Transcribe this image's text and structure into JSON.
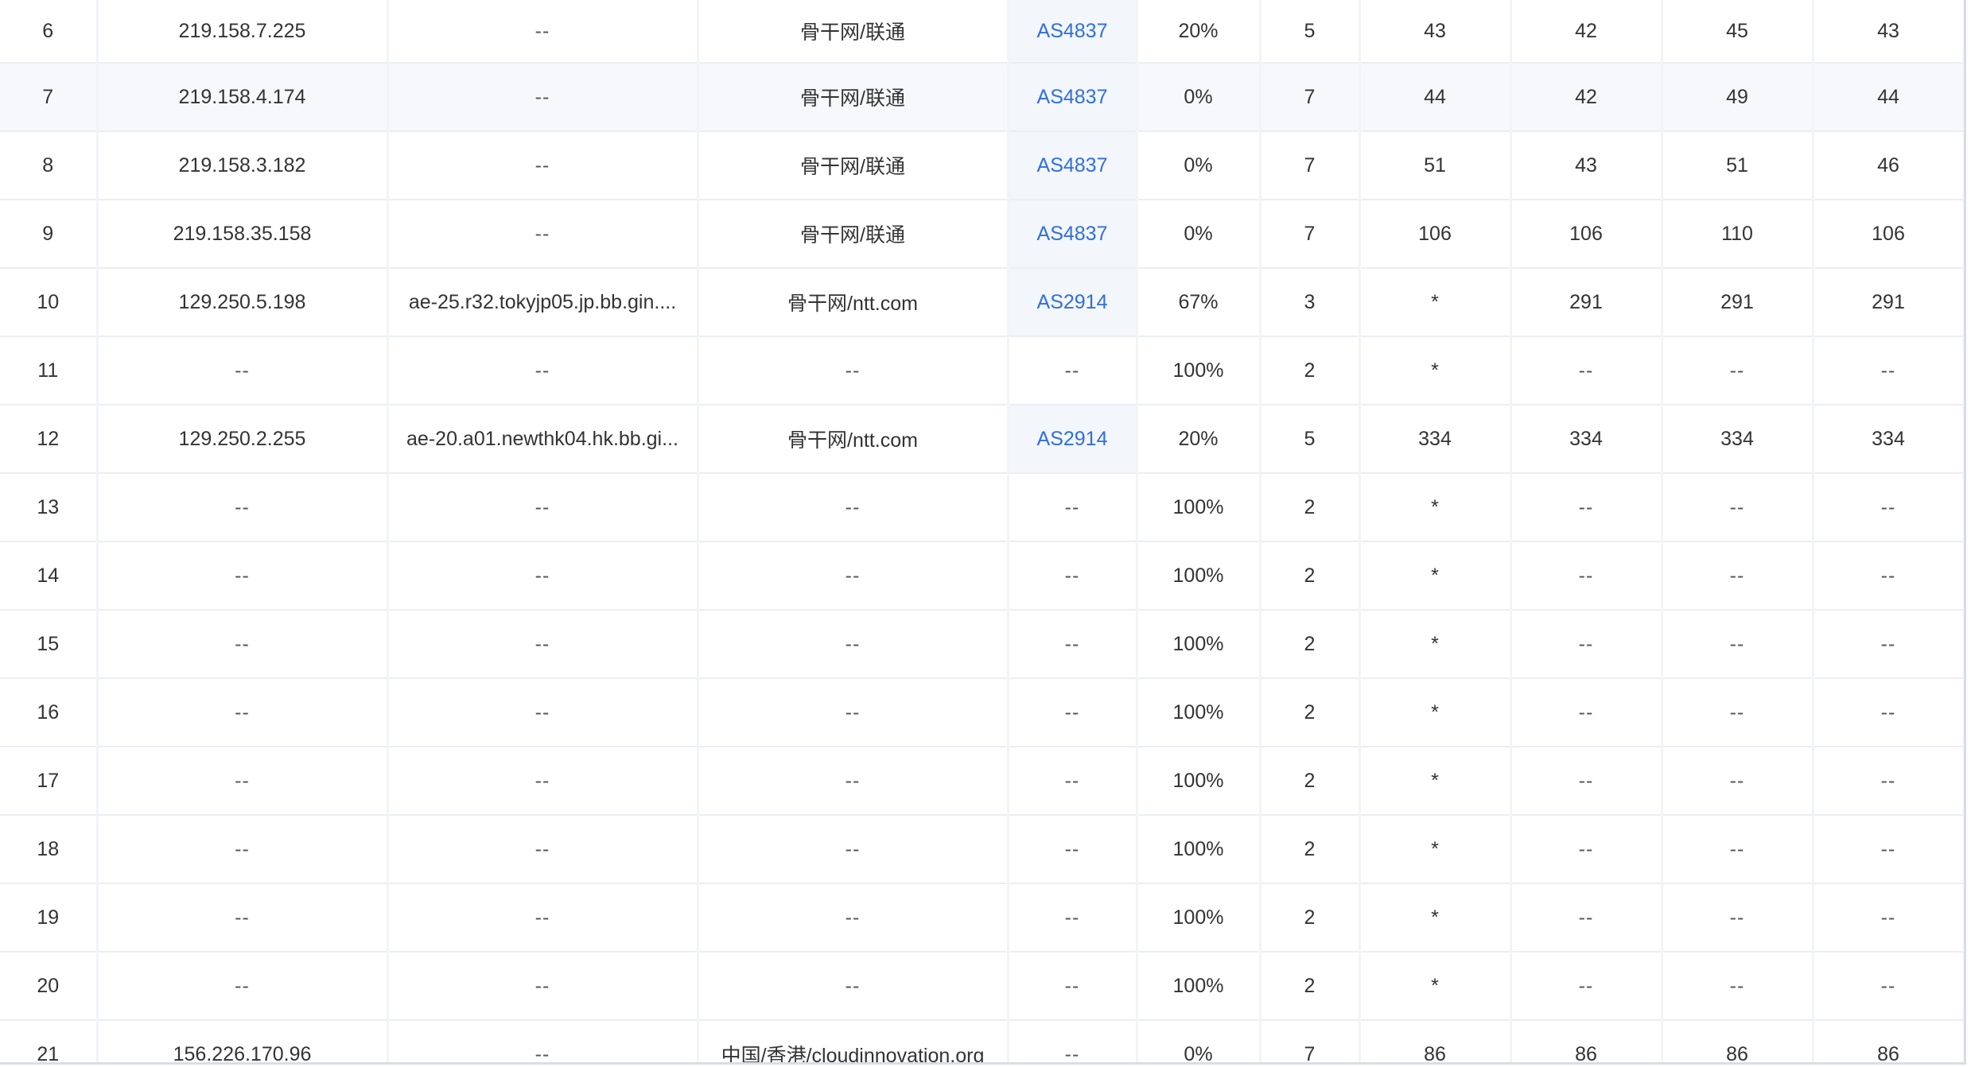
{
  "colors": {
    "link": "#2f6fdf",
    "text": "#333333",
    "hover_row": "#f6f8fb",
    "asn_cell_bg": "#f3f6fa",
    "border": "#ebeef3"
  },
  "rows": [
    {
      "hop": "6",
      "ip": "219.158.7.225",
      "host": "--",
      "location": "骨干网/联通",
      "asn": "AS4837",
      "loss": "20%",
      "sent": "5",
      "last": "43",
      "best": "42",
      "worst": "45",
      "avg": "43"
    },
    {
      "hop": "7",
      "ip": "219.158.4.174",
      "host": "--",
      "location": "骨干网/联通",
      "asn": "AS4837",
      "loss": "0%",
      "sent": "7",
      "last": "44",
      "best": "42",
      "worst": "49",
      "avg": "44"
    },
    {
      "hop": "8",
      "ip": "219.158.3.182",
      "host": "--",
      "location": "骨干网/联通",
      "asn": "AS4837",
      "loss": "0%",
      "sent": "7",
      "last": "51",
      "best": "43",
      "worst": "51",
      "avg": "46"
    },
    {
      "hop": "9",
      "ip": "219.158.35.158",
      "host": "--",
      "location": "骨干网/联通",
      "asn": "AS4837",
      "loss": "0%",
      "sent": "7",
      "last": "106",
      "best": "106",
      "worst": "110",
      "avg": "106"
    },
    {
      "hop": "10",
      "ip": "129.250.5.198",
      "host": "ae-25.r32.tokyjp05.jp.bb.gin....",
      "location": "骨干网/ntt.com",
      "asn": "AS2914",
      "loss": "67%",
      "sent": "3",
      "last": "*",
      "best": "291",
      "worst": "291",
      "avg": "291"
    },
    {
      "hop": "11",
      "ip": "--",
      "host": "--",
      "location": "--",
      "asn": "--",
      "loss": "100%",
      "sent": "2",
      "last": "*",
      "best": "--",
      "worst": "--",
      "avg": "--"
    },
    {
      "hop": "12",
      "ip": "129.250.2.255",
      "host": "ae-20.a01.newthk04.hk.bb.gi...",
      "location": "骨干网/ntt.com",
      "asn": "AS2914",
      "loss": "20%",
      "sent": "5",
      "last": "334",
      "best": "334",
      "worst": "334",
      "avg": "334"
    },
    {
      "hop": "13",
      "ip": "--",
      "host": "--",
      "location": "--",
      "asn": "--",
      "loss": "100%",
      "sent": "2",
      "last": "*",
      "best": "--",
      "worst": "--",
      "avg": "--"
    },
    {
      "hop": "14",
      "ip": "--",
      "host": "--",
      "location": "--",
      "asn": "--",
      "loss": "100%",
      "sent": "2",
      "last": "*",
      "best": "--",
      "worst": "--",
      "avg": "--"
    },
    {
      "hop": "15",
      "ip": "--",
      "host": "--",
      "location": "--",
      "asn": "--",
      "loss": "100%",
      "sent": "2",
      "last": "*",
      "best": "--",
      "worst": "--",
      "avg": "--"
    },
    {
      "hop": "16",
      "ip": "--",
      "host": "--",
      "location": "--",
      "asn": "--",
      "loss": "100%",
      "sent": "2",
      "last": "*",
      "best": "--",
      "worst": "--",
      "avg": "--"
    },
    {
      "hop": "17",
      "ip": "--",
      "host": "--",
      "location": "--",
      "asn": "--",
      "loss": "100%",
      "sent": "2",
      "last": "*",
      "best": "--",
      "worst": "--",
      "avg": "--"
    },
    {
      "hop": "18",
      "ip": "--",
      "host": "--",
      "location": "--",
      "asn": "--",
      "loss": "100%",
      "sent": "2",
      "last": "*",
      "best": "--",
      "worst": "--",
      "avg": "--"
    },
    {
      "hop": "19",
      "ip": "--",
      "host": "--",
      "location": "--",
      "asn": "--",
      "loss": "100%",
      "sent": "2",
      "last": "*",
      "best": "--",
      "worst": "--",
      "avg": "--"
    },
    {
      "hop": "20",
      "ip": "--",
      "host": "--",
      "location": "--",
      "asn": "--",
      "loss": "100%",
      "sent": "2",
      "last": "*",
      "best": "--",
      "worst": "--",
      "avg": "--"
    },
    {
      "hop": "21",
      "ip": "156.226.170.96",
      "host": "--",
      "location": "中国/香港/cloudinnovation.org",
      "asn": "--",
      "loss": "0%",
      "sent": "7",
      "last": "86",
      "best": "86",
      "worst": "86",
      "avg": "86"
    }
  ]
}
